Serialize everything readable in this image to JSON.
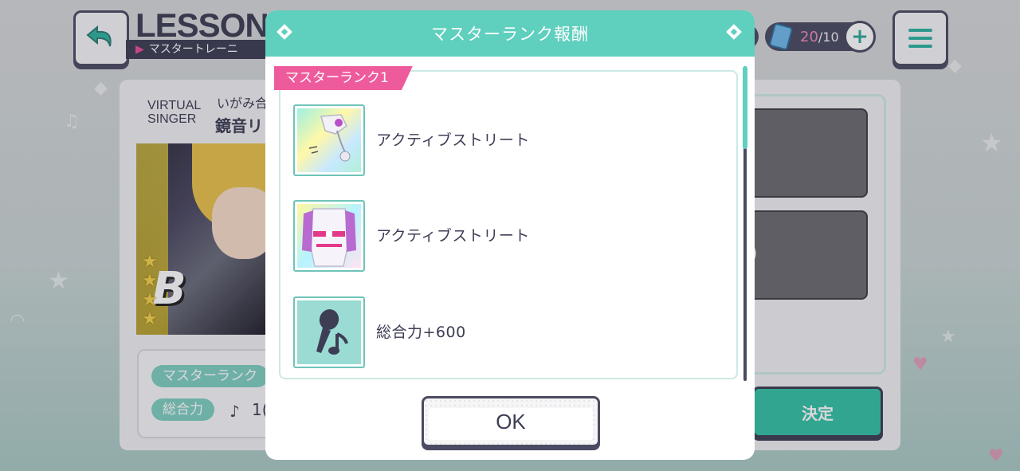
{
  "background": {
    "lesson_title": "LESSON",
    "lesson_subtitle": "マスタートレーニ",
    "stamina": {
      "current": "20",
      "max": "/10"
    },
    "character": {
      "unit_logo_line1": "VIRTUAL",
      "unit_logo_line2": "SINGER",
      "card_subtitle": "いがみ合",
      "name": "鏡音リ",
      "rarity_stars": 4
    },
    "info": {
      "master_rank_pill": "マスターランク",
      "total_power_pill": "総合力",
      "total_power_value": "1("
    },
    "right_box_value": ")",
    "decide_label": "決定"
  },
  "modal": {
    "title": "マスターランク報酬",
    "rank_tag": "マスターランク1",
    "rewards": [
      {
        "type": "hair",
        "icon": "costume-hair-icon",
        "label": "アクティブストリート"
      },
      {
        "type": "outfit",
        "icon": "costume-outfit-icon",
        "label": "アクティブストリート"
      },
      {
        "type": "power",
        "icon": "microphone-note-icon",
        "label": "総合力+600"
      }
    ],
    "ok_label": "OK"
  },
  "colors": {
    "header_teal": "#5fcfbe",
    "tag_pink": "#ee5b9c",
    "text_dark": "#3d3d55",
    "stamina_pink": "#f08ab8",
    "decide_green": "#35c1a6"
  }
}
